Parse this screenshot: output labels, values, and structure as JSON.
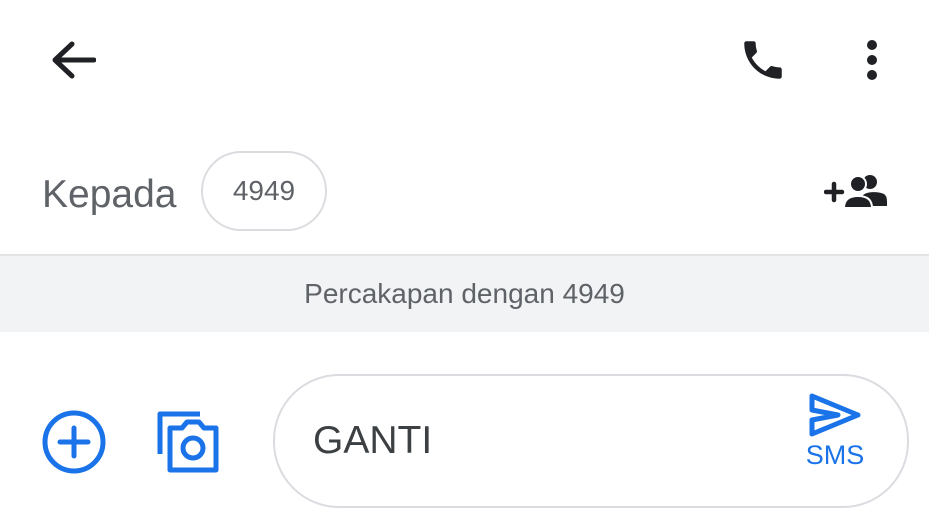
{
  "toolbar": {
    "back_icon": "arrow-left-icon",
    "call_icon": "phone-icon",
    "more_icon": "more-vert-icon"
  },
  "recipient": {
    "to_label": "Kepada",
    "chip_value": "4949",
    "add_people_icon": "group-add-icon"
  },
  "conversation": {
    "banner_text": "Percakapan dengan 4949"
  },
  "compose": {
    "add_icon": "add-circle-icon",
    "camera_icon": "camera-gallery-icon",
    "message_value": "GANTI",
    "send_label": "SMS",
    "send_icon": "send-icon"
  },
  "colors": {
    "accent": "#1a73e8",
    "icon_dark": "#202124",
    "text_secondary": "#5f6368",
    "band_bg": "#f1f3f4",
    "border": "#dadce0"
  }
}
